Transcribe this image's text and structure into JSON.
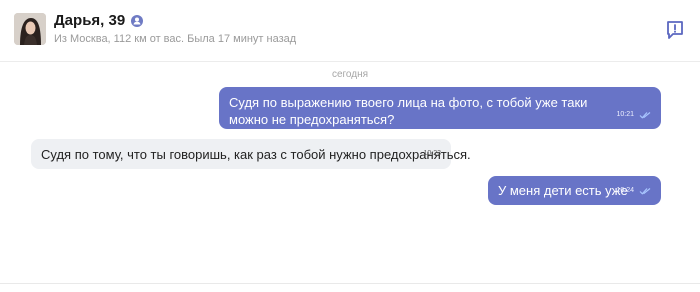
{
  "header": {
    "name": "Дарья, 39",
    "subline": "Из Москва, 112 км от вас. Была 17 минут назад",
    "avatar_icon": "user-photo",
    "badge_icon": "verified-user-icon",
    "report_icon": "report-flag-icon"
  },
  "chat": {
    "date_label": "сегодня",
    "messages": [
      {
        "direction": "outgoing",
        "text": "Судя по выражению твоего лица на фото, с тобой уже таки можно не предохраняться?",
        "time": "10:21",
        "read": true
      },
      {
        "direction": "incoming",
        "text": "Судя по тому, что ты говоришь, как раз с тобой нужно предохраняться.",
        "time": "10:23"
      },
      {
        "direction": "outgoing",
        "text": "У меня дети есть уже",
        "time": "10:24",
        "read": true
      }
    ]
  },
  "colors": {
    "outgoing_bubble": "#6874c7",
    "incoming_bubble": "#eef0f3",
    "accent": "#5b67c0"
  }
}
